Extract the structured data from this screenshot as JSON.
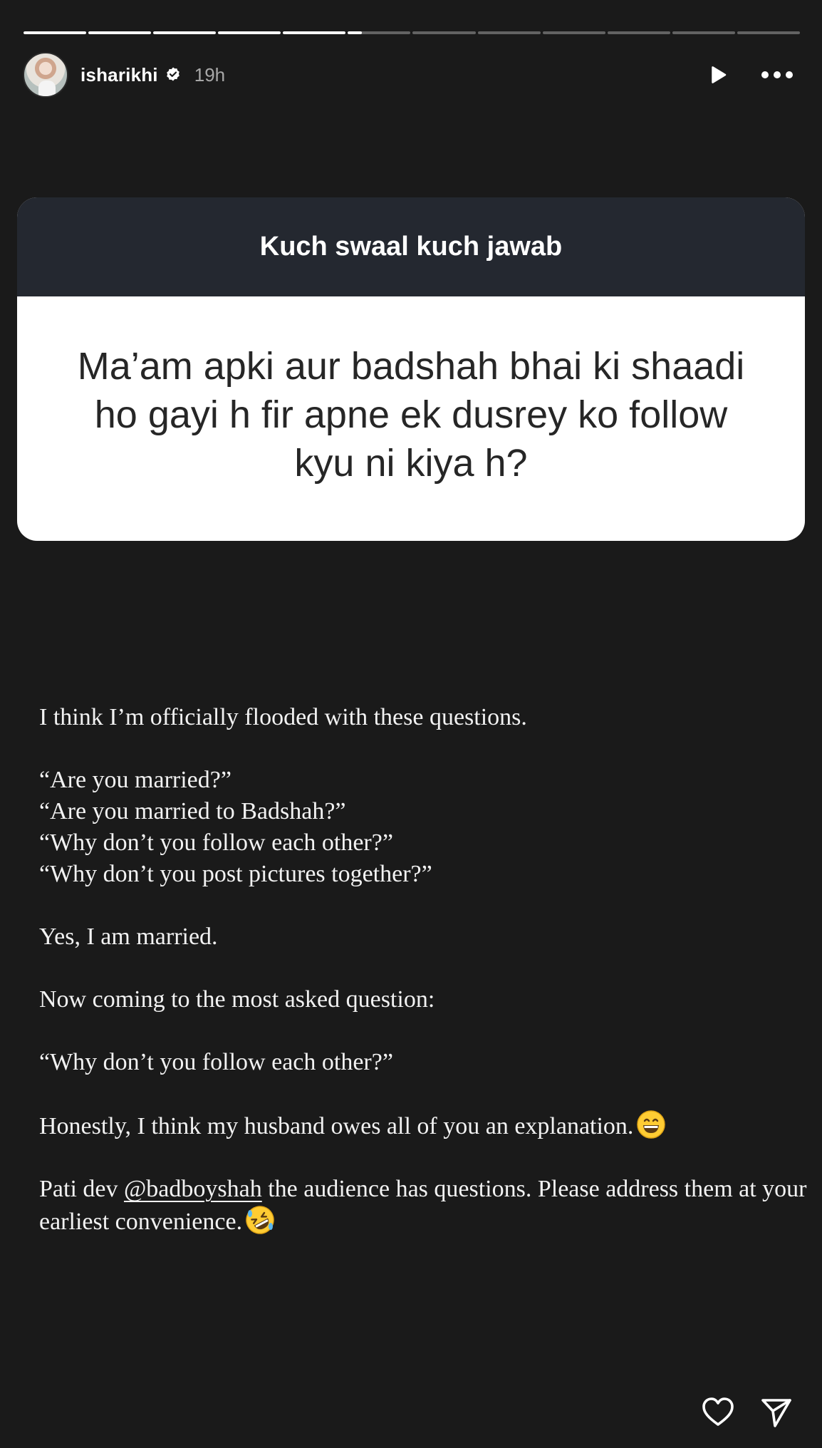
{
  "story": {
    "progress_segments": [
      1,
      1,
      1,
      1,
      1,
      0.22,
      0,
      0,
      0,
      0,
      0,
      0
    ],
    "active_segment": 6,
    "total_segments": 12
  },
  "header": {
    "avatar_icon": "profile-avatar",
    "username": "isharikhi",
    "verified_icon": "verified-badge-icon",
    "time": "19h",
    "play_icon": "play-icon",
    "more_icon": "more-horizontal-icon"
  },
  "question_card": {
    "title": "Kuch swaal kuch jawab",
    "question": "Ma’am apki aur badshah bhai ki shaadi ho gayi h fir apne ek dusrey ko follow kyu ni kiya h?"
  },
  "answer": {
    "line1": "I think I’m officially flooded with these questions.",
    "q1": "“Are you married?”",
    "q2": "“Are you married to Badshah?”",
    "q3": "“Why don’t you follow each other?”",
    "q4": "“Why don’t you post pictures together?”",
    "yes": "Yes, I am married.",
    "most_asked": "Now coming to the most asked question:",
    "q_repeat": "“Why don’t you follow each other?”",
    "honestly": "Honestly, I think my husband owes all of you an explanation.",
    "honestly_emoji": "grinning-face-emoji",
    "pati_prefix": "Pati dev ",
    "mention": "@badboyshah",
    "pati_suffix": " the audience has questions. Please address them at your earliest convenience.",
    "final_emoji": "rolling-laughing-emoji"
  },
  "footer": {
    "like_icon": "heart-icon",
    "share_icon": "send-icon"
  },
  "colors": {
    "background": "#1a1a1a",
    "card_header": "#242830",
    "card_body": "#ffffff",
    "question_text": "#262626",
    "answer_text": "#f2f2f2"
  }
}
